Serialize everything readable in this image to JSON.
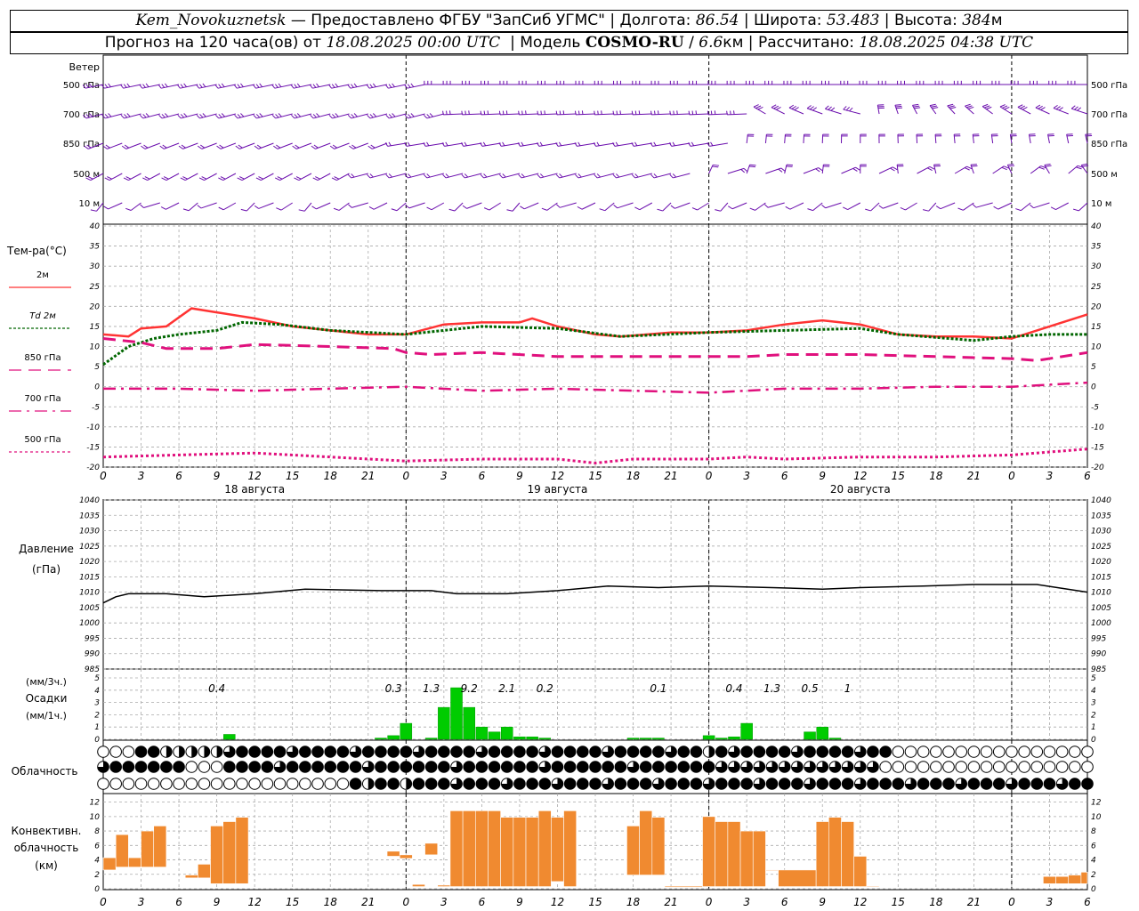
{
  "header": {
    "station": "Kem_Novokuznetsk",
    "provider": "Предоставлено ФГБУ \"ЗапСиб УГМС\"",
    "lon_label": "Долгота:",
    "lon_value": "86.54",
    "lat_label": "Широта:",
    "lat_value": "53.483",
    "alt_label": "Высота:",
    "alt_value": "384",
    "alt_unit": "м",
    "forecast_label": "Прогноз на 120 часа(ов) от",
    "forecast_start": "18.08.2025 00:00 UTC",
    "model_label": "Модель",
    "model_name": "COSMO-RU",
    "model_res": "6.6",
    "model_res_unit": "км",
    "computed_label": "Рассчитано:",
    "computed_at": "18.08.2025 04:38 UTC"
  },
  "colors": {
    "wind": "#6a0dad",
    "t2m": "#ff3333",
    "td2m": "#006600",
    "t850": "#e0107d",
    "pressure": "#000000",
    "precip": "#00cc00",
    "conv": "#f08a30",
    "grid": "#aaaaaa"
  },
  "hour_ticks": [
    "0",
    "3",
    "6",
    "9",
    "12",
    "15",
    "18",
    "21",
    "0",
    "3",
    "6",
    "9",
    "12",
    "15",
    "18",
    "21",
    "0",
    "3",
    "6",
    "9",
    "12",
    "15",
    "18",
    "21",
    "0",
    "3",
    "6"
  ],
  "conv_hour_ticks": [
    "0",
    "3",
    "6",
    "9",
    "12",
    "15",
    "18",
    "21",
    "0",
    "3",
    "6",
    "9",
    "12",
    "15",
    "18",
    "21",
    "0",
    "3",
    "6",
    "9",
    "12",
    "15",
    "18",
    "21",
    "0",
    "3",
    "6"
  ],
  "day_labels": [
    "18 августа",
    "19 августа",
    "20 августа"
  ],
  "wind": {
    "title": "Ветер",
    "levels": [
      "500 гПа",
      "700 гПа",
      "850 гПа",
      "500 м",
      "10  м"
    ]
  },
  "temp": {
    "title": "Тем-ра(°С)",
    "legend": [
      {
        "label": "2м",
        "style": "solid",
        "color": "#ff3333"
      },
      {
        "label": "Td  2м",
        "style": "dotted",
        "color": "#006600"
      },
      {
        "label": "850 гПа",
        "style": "dash",
        "color": "#e0107d"
      },
      {
        "label": "700 гПа",
        "style": "dashdot",
        "color": "#e0107d"
      },
      {
        "label": "500 гПа",
        "style": "dot",
        "color": "#e0107d"
      }
    ],
    "yticks": [
      "40",
      "35",
      "30",
      "25",
      "20",
      "15",
      "10",
      "5",
      "0",
      "-5",
      "-10",
      "-15",
      "-20"
    ]
  },
  "pressure": {
    "title": "Давление",
    "unit": "(гПа)",
    "yticks": [
      "1040",
      "1035",
      "1030",
      "1025",
      "1020",
      "1015",
      "1010",
      "1005",
      "1000",
      "995",
      "990",
      "985"
    ]
  },
  "precip": {
    "label_top": "(мм/3ч.)",
    "title": "Осадки",
    "label_bottom": "(мм/1ч.)",
    "yticks": [
      "5",
      "4",
      "3",
      "2",
      "1",
      "0"
    ],
    "sums": [
      {
        "h": 9,
        "v": "0.4"
      },
      {
        "h": 23,
        "v": "0.3"
      },
      {
        "h": 26,
        "v": "1.3"
      },
      {
        "h": 29,
        "v": "9.2"
      },
      {
        "h": 32,
        "v": "2.1"
      },
      {
        "h": 35,
        "v": "0.2"
      },
      {
        "h": 44,
        "v": "0.1"
      },
      {
        "h": 50,
        "v": "0.4"
      },
      {
        "h": 53,
        "v": "1.3"
      },
      {
        "h": 56,
        "v": "0.5"
      },
      {
        "h": 59,
        "v": "1"
      }
    ]
  },
  "cloud": {
    "title": "Облачность"
  },
  "conv": {
    "title1": "Конвективн.",
    "title2": "облачность",
    "title3": "(км)",
    "yticks": [
      "12",
      "10",
      "8",
      "6",
      "4",
      "2",
      "0"
    ]
  },
  "chart_data": [
    {
      "type": "line",
      "title": "Тем-ра(°С)",
      "xlabel": "",
      "ylabel": "Тем-ра(°С)",
      "ylim": [
        -20,
        40
      ],
      "x_hours": [
        0,
        6,
        12,
        18,
        24,
        30,
        36,
        42,
        48,
        54,
        60,
        66,
        72,
        78
      ],
      "series": [
        {
          "name": "2м",
          "values": [
            [
              0,
              13
            ],
            [
              2,
              12.5
            ],
            [
              3,
              14.5
            ],
            [
              5,
              15
            ],
            [
              7,
              19.5
            ],
            [
              9,
              18.5
            ],
            [
              12,
              17
            ],
            [
              15,
              15
            ],
            [
              18,
              14
            ],
            [
              21,
              13
            ],
            [
              24,
              13
            ],
            [
              27,
              15.5
            ],
            [
              30,
              16
            ],
            [
              33,
              16
            ],
            [
              34,
              17
            ],
            [
              36,
              15
            ],
            [
              39,
              13
            ],
            [
              41,
              12.5
            ],
            [
              45,
              13.5
            ],
            [
              48,
              13.5
            ],
            [
              51,
              14
            ],
            [
              54,
              15.5
            ],
            [
              57,
              16.5
            ],
            [
              60,
              15.5
            ],
            [
              63,
              13
            ],
            [
              66,
              12.5
            ],
            [
              69,
              12.5
            ],
            [
              72,
              12
            ],
            [
              75,
              15
            ],
            [
              78,
              18
            ]
          ]
        },
        {
          "name": "Td  2м",
          "values": [
            [
              0,
              5.5
            ],
            [
              2,
              10
            ],
            [
              4,
              12
            ],
            [
              6,
              13
            ],
            [
              9,
              14
            ],
            [
              11,
              16
            ],
            [
              14,
              15.5
            ],
            [
              18,
              14
            ],
            [
              24,
              13
            ],
            [
              30,
              15
            ],
            [
              36,
              14.5
            ],
            [
              41,
              12.5
            ],
            [
              48,
              13.5
            ],
            [
              54,
              14
            ],
            [
              60,
              14.5
            ],
            [
              63,
              13
            ],
            [
              69,
              11.5
            ],
            [
              72,
              12.5
            ],
            [
              75,
              13
            ],
            [
              78,
              13
            ]
          ]
        },
        {
          "name": "850 гПа",
          "values": [
            [
              0,
              12
            ],
            [
              3,
              11
            ],
            [
              5,
              9.5
            ],
            [
              9,
              9.5
            ],
            [
              12,
              10.5
            ],
            [
              18,
              10
            ],
            [
              23,
              9.5
            ],
            [
              24,
              8.5
            ],
            [
              26,
              8
            ],
            [
              30,
              8.5
            ],
            [
              36,
              7.5
            ],
            [
              42,
              7.5
            ],
            [
              48,
              7.5
            ],
            [
              51,
              7.5
            ],
            [
              54,
              8
            ],
            [
              60,
              8
            ],
            [
              66,
              7.5
            ],
            [
              72,
              7
            ],
            [
              74,
              6.5
            ],
            [
              78,
              8.5
            ]
          ]
        },
        {
          "name": "700 гПа",
          "values": [
            [
              0,
              -0.5
            ],
            [
              6,
              -0.5
            ],
            [
              12,
              -1
            ],
            [
              18,
              -0.5
            ],
            [
              24,
              0
            ],
            [
              30,
              -1
            ],
            [
              36,
              -0.5
            ],
            [
              42,
              -1
            ],
            [
              48,
              -1.5
            ],
            [
              54,
              -0.5
            ],
            [
              60,
              -0.5
            ],
            [
              66,
              0
            ],
            [
              72,
              0
            ],
            [
              78,
              1
            ]
          ]
        },
        {
          "name": "500 гПа",
          "values": [
            [
              0,
              -17.5
            ],
            [
              6,
              -17
            ],
            [
              12,
              -16.5
            ],
            [
              18,
              -17.5
            ],
            [
              24,
              -18.5
            ],
            [
              30,
              -18
            ],
            [
              36,
              -18
            ],
            [
              39,
              -19
            ],
            [
              42,
              -18
            ],
            [
              48,
              -18
            ],
            [
              51,
              -17.5
            ],
            [
              54,
              -18
            ],
            [
              60,
              -17.5
            ],
            [
              66,
              -17.5
            ],
            [
              72,
              -17
            ],
            [
              78,
              -15.5
            ]
          ]
        }
      ]
    },
    {
      "type": "line",
      "title": "Давление",
      "ylabel": "Давление (гПа)",
      "ylim": [
        985,
        1040
      ],
      "series": [
        {
          "name": "",
          "values": [
            [
              0,
              1006.5
            ],
            [
              1,
              1008.5
            ],
            [
              2,
              1009.5
            ],
            [
              5,
              1009.5
            ],
            [
              8,
              1008.5
            ],
            [
              12,
              1009.5
            ],
            [
              16,
              1011
            ],
            [
              22,
              1010.5
            ],
            [
              26,
              1010.5
            ],
            [
              28,
              1009.5
            ],
            [
              32,
              1009.5
            ],
            [
              36,
              1010.5
            ],
            [
              40,
              1012
            ],
            [
              44,
              1011.5
            ],
            [
              48,
              1012
            ],
            [
              53,
              1011.5
            ],
            [
              57,
              1011
            ],
            [
              60,
              1011.5
            ],
            [
              65,
              1012
            ],
            [
              69,
              1012.5
            ],
            [
              74,
              1012.5
            ],
            [
              78,
              1010
            ]
          ]
        }
      ]
    },
    {
      "type": "bar",
      "title": "Осадки",
      "ylabel": "мм/1ч.",
      "ylim": [
        0,
        5
      ],
      "hours": [
        10,
        22,
        23,
        24,
        26,
        27,
        28,
        29,
        30,
        31,
        32,
        33,
        34,
        35,
        42,
        43,
        44,
        48,
        49,
        50,
        51,
        56,
        57,
        58
      ],
      "values": [
        0.4,
        0.1,
        0.3,
        1.3,
        0.1,
        2.6,
        4.2,
        2.6,
        1.0,
        0.6,
        1.0,
        0.2,
        0.2,
        0.1,
        0.1,
        0.1,
        0.1,
        0.3,
        0.1,
        0.2,
        1.3,
        0.6,
        1.0,
        0.1
      ]
    },
    {
      "type": "bar",
      "title": "Конвективн. облачность (км)",
      "ylim": [
        0,
        13
      ],
      "segments": [
        {
          "h0": 0,
          "h1": 1,
          "base": 2.6,
          "top": 4.3
        },
        {
          "h0": 1,
          "h1": 2,
          "base": 3.0,
          "top": 7.5
        },
        {
          "h0": 2,
          "h1": 3,
          "base": 3.0,
          "top": 4.3
        },
        {
          "h0": 3,
          "h1": 4,
          "base": 3.0,
          "top": 8.0
        },
        {
          "h0": 4,
          "h1": 5,
          "base": 3.0,
          "top": 8.7
        },
        {
          "h0": 6.5,
          "h1": 7.5,
          "base": 1.5,
          "top": 1.9
        },
        {
          "h0": 7.5,
          "h1": 8.5,
          "base": 1.5,
          "top": 3.4
        },
        {
          "h0": 8.5,
          "h1": 9.5,
          "base": 0.7,
          "top": 8.7
        },
        {
          "h0": 9.5,
          "h1": 10.5,
          "base": 0.7,
          "top": 9.3
        },
        {
          "h0": 10.5,
          "h1": 11.5,
          "base": 0.7,
          "top": 9.9
        },
        {
          "h0": 22.5,
          "h1": 23.5,
          "base": 4.5,
          "top": 5.2
        },
        {
          "h0": 23.5,
          "h1": 24.5,
          "base": 4.2,
          "top": 4.7
        },
        {
          "h0": 24.5,
          "h1": 25.5,
          "base": 0.3,
          "top": 0.6
        },
        {
          "h0": 25.5,
          "h1": 26.5,
          "base": 4.7,
          "top": 6.3
        },
        {
          "h0": 26.5,
          "h1": 27.5,
          "base": 0.3,
          "top": 0.5
        },
        {
          "h0": 27.5,
          "h1": 28.5,
          "base": 0.3,
          "top": 10.8
        },
        {
          "h0": 28.5,
          "h1": 29.5,
          "base": 0.3,
          "top": 10.8
        },
        {
          "h0": 29.5,
          "h1": 30.5,
          "base": 0.3,
          "top": 10.8
        },
        {
          "h0": 30.5,
          "h1": 31.5,
          "base": 0.3,
          "top": 10.8
        },
        {
          "h0": 31.5,
          "h1": 32.5,
          "base": 0.3,
          "top": 9.9
        },
        {
          "h0": 32.5,
          "h1": 33.5,
          "base": 0.3,
          "top": 9.9
        },
        {
          "h0": 33.5,
          "h1": 34.5,
          "base": 0.3,
          "top": 9.9
        },
        {
          "h0": 34.5,
          "h1": 35.5,
          "base": 0.3,
          "top": 10.8
        },
        {
          "h0": 35.5,
          "h1": 36.5,
          "base": 1.0,
          "top": 9.9
        },
        {
          "h0": 36.5,
          "h1": 37.5,
          "base": 0.3,
          "top": 10.8
        },
        {
          "h0": 41.5,
          "h1": 42.5,
          "base": 1.9,
          "top": 8.7
        },
        {
          "h0": 42.5,
          "h1": 43.5,
          "base": 1.9,
          "top": 10.8
        },
        {
          "h0": 43.5,
          "h1": 44.5,
          "base": 1.9,
          "top": 9.9
        },
        {
          "h0": 44.5,
          "h1": 47.5,
          "base": 0.2,
          "top": 0.35
        },
        {
          "h0": 47.5,
          "h1": 48.5,
          "base": 0.3,
          "top": 10.0
        },
        {
          "h0": 48.5,
          "h1": 49.5,
          "base": 0.3,
          "top": 9.3
        },
        {
          "h0": 49.5,
          "h1": 50.5,
          "base": 0.3,
          "top": 9.3
        },
        {
          "h0": 50.5,
          "h1": 51.5,
          "base": 0.3,
          "top": 8.0
        },
        {
          "h0": 51.5,
          "h1": 52.5,
          "base": 0.3,
          "top": 8.0
        },
        {
          "h0": 52.5,
          "h1": 53.5,
          "base": 2.5,
          "top": 2.6
        },
        {
          "h0": 53.5,
          "h1": 56.5,
          "base": 0.3,
          "top": 2.6
        },
        {
          "h0": 56.5,
          "h1": 57.5,
          "base": 0.3,
          "top": 9.3
        },
        {
          "h0": 57.5,
          "h1": 58.5,
          "base": 0.3,
          "top": 9.9
        },
        {
          "h0": 58.5,
          "h1": 59.5,
          "base": 0.3,
          "top": 9.3
        },
        {
          "h0": 59.5,
          "h1": 60.5,
          "base": 0.3,
          "top": 4.5
        },
        {
          "h0": 60.5,
          "h1": 61.5,
          "base": 0.3,
          "top": 0.4
        },
        {
          "h0": 74.5,
          "h1": 75.5,
          "base": 0.7,
          "top": 1.7
        },
        {
          "h0": 75.5,
          "h1": 76.5,
          "base": 0.7,
          "top": 1.7
        },
        {
          "h0": 76.5,
          "h1": 77.5,
          "base": 0.7,
          "top": 1.9
        },
        {
          "h0": 77.5,
          "h1": 78,
          "base": 0.7,
          "top": 2.3
        }
      ]
    }
  ]
}
